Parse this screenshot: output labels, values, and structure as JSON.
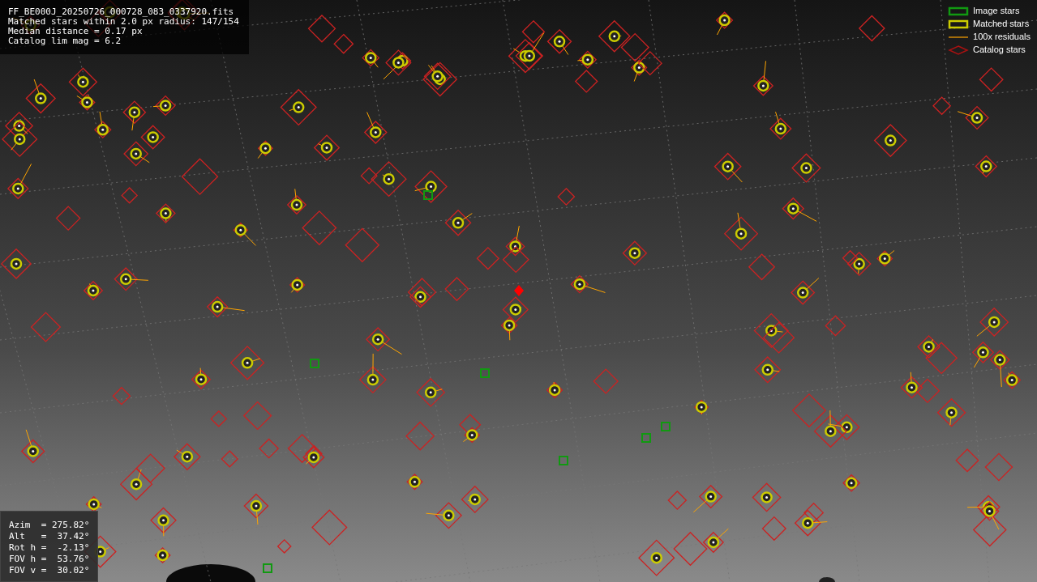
{
  "info_lines": [
    "FF_BE000J_20250726_000728_083_0337920.fits",
    "Matched stars within 2.0 px radius: 147/154",
    "Median distance = 0.17 px",
    "Catalog lim mag = 6.2"
  ],
  "legend": [
    {
      "label": "Image stars"
    },
    {
      "kind": "matched",
      "label": "Matched stars"
    },
    {
      "kind": "residual",
      "label": "100x residuals"
    },
    {
      "kind": "catalog",
      "label": "Catalog stars"
    }
  ],
  "pointing": [
    "Azim  = 275.82°",
    "Alt   =  37.42°",
    "Rot h =  -2.13°",
    "FOV h =  53.76°",
    "FOV v =  30.02°"
  ]
}
